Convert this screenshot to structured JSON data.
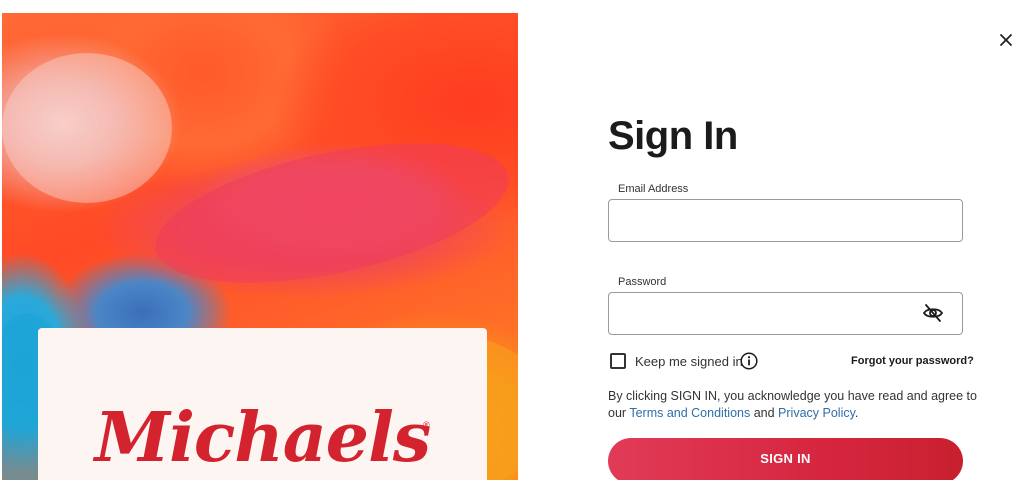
{
  "brand": {
    "logo_text": "Michaels",
    "logo_mark": "®",
    "logo_color": "#d2232e"
  },
  "dialog": {
    "close_icon": "close-icon",
    "title": "Sign In"
  },
  "form": {
    "email_label": "Email Address",
    "email_value": "",
    "password_label": "Password",
    "password_value": "",
    "password_visibility_icon": "eye-slash-icon",
    "keep_signed_in_label": "Keep me signed in",
    "keep_signed_in_checked": false,
    "info_icon": "info-icon",
    "forgot_password": "Forgot your password?",
    "legal_prefix": "By clicking SIGN IN, you acknowledge you have read and agree to our ",
    "terms_link": "Terms and Conditions",
    "legal_and": " and ",
    "privacy_link": "Privacy Policy",
    "legal_suffix": ".",
    "submit_label": "SIGN IN"
  },
  "colors": {
    "accent": "#d6263f",
    "link": "#2f6ea8"
  }
}
